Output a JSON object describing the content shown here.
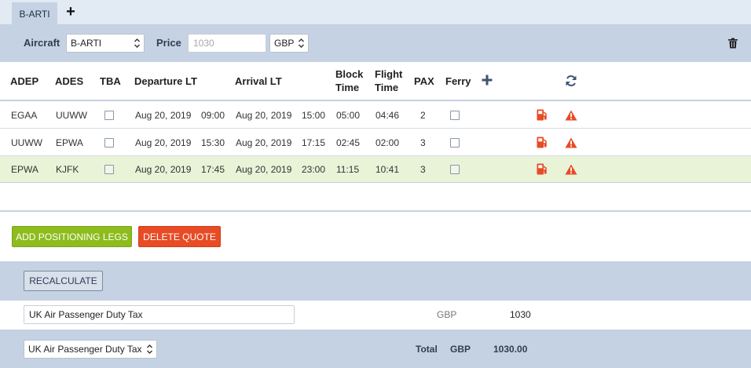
{
  "tabs": [
    {
      "label": "B-ARTI"
    }
  ],
  "aircraft_bar": {
    "aircraft_label": "Aircraft",
    "aircraft_value": "B-ARTI",
    "price_label": "Price",
    "price_placeholder": "1030",
    "currency_value": "GBP"
  },
  "legs_table": {
    "headers": {
      "adep": "ADEP",
      "ades": "ADES",
      "tba": "TBA",
      "departure": "Departure LT",
      "arrival": "Arrival LT",
      "block_1": "Block",
      "block_2": "Time",
      "flight_1": "Flight",
      "flight_2": "Time",
      "pax": "PAX",
      "ferry": "Ferry"
    },
    "rows": [
      {
        "adep": "EGAA",
        "ades": "UUWW",
        "dep_date": "Aug 20, 2019",
        "dep_time": "09:00",
        "arr_date": "Aug 20, 2019",
        "arr_time": "15:00",
        "block": "05:00",
        "flight": "04:46",
        "pax": "2"
      },
      {
        "adep": "UUWW",
        "ades": "EPWA",
        "dep_date": "Aug 20, 2019",
        "dep_time": "15:30",
        "arr_date": "Aug 20, 2019",
        "arr_time": "17:15",
        "block": "02:45",
        "flight": "02:00",
        "pax": "3"
      },
      {
        "adep": "EPWA",
        "ades": "KJFK",
        "dep_date": "Aug 20, 2019",
        "dep_time": "17:45",
        "arr_date": "Aug 20, 2019",
        "arr_time": "23:00",
        "block": "11:15",
        "flight": "10:41",
        "pax": "3"
      }
    ]
  },
  "actions": {
    "add_positioning": "ADD POSITIONING LEGS",
    "delete_quote": "DELETE QUOTE",
    "recalculate": "RECALCULATE"
  },
  "tax": {
    "name_value": "UK Air Passenger Duty Tax",
    "currency": "GBP",
    "amount": "1030"
  },
  "total": {
    "select_value": "UK Air Passenger Duty Tax",
    "label": "Total",
    "currency": "GBP",
    "amount": "1030.00"
  },
  "colors": {
    "accent_green": "#8dbc1c",
    "danger_red": "#e84b25",
    "panel_blue": "#c5d2e3",
    "row_highlight": "#e9f3d8"
  },
  "icons": [
    "plus-icon",
    "trash-icon",
    "refresh-icon",
    "fuel-icon",
    "warning-icon",
    "select-arrows-icon"
  ]
}
